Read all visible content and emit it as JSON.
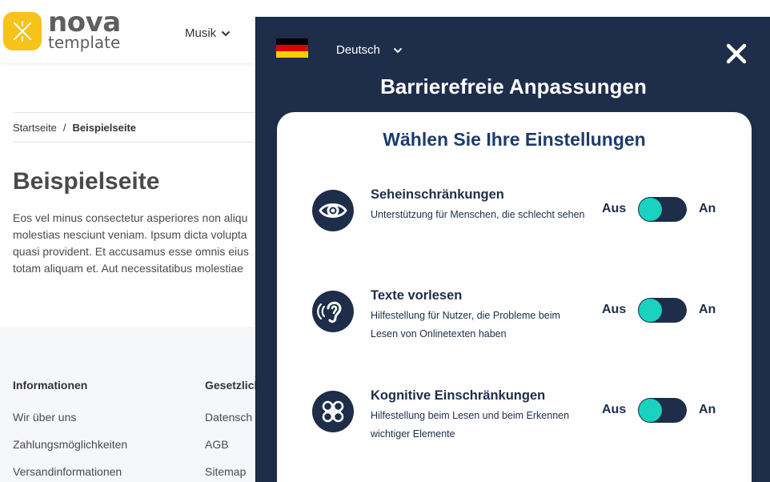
{
  "header": {
    "logo_word": "nova",
    "logo_sub": "template",
    "nav_item": "Musik"
  },
  "breadcrumb": {
    "home": "Startseite",
    "separator": "/",
    "current": "Beispielseite"
  },
  "page": {
    "title": "Beispielseite",
    "body_lines": [
      "Eos vel minus consectetur asperiores non aliqu",
      "molestias nesciunt veniam. Ipsum dicta volupta",
      "quasi provident. Et accusamus esse omnis eius",
      "totam aliquam et. Aut necessitatibus molestiae"
    ]
  },
  "footer": {
    "col1": {
      "heading": "Informationen",
      "links": [
        "Wir über uns",
        "Zahlungsmöglichkeiten",
        "Versandinformationen"
      ]
    },
    "col2": {
      "heading": "Gesetzlich",
      "links": [
        "Datensch",
        "AGB",
        "Sitemap"
      ]
    }
  },
  "accessibility_panel": {
    "language": "Deutsch",
    "flag_colors": [
      "#000000",
      "#dd0000",
      "#ffce00"
    ],
    "title": "Barrierefreie Anpassungen",
    "card_title": "Wählen Sie Ihre Einstellungen",
    "off_label": "Aus",
    "on_label": "An",
    "options": [
      {
        "title": "Seheinschränkungen",
        "desc": "Unterstützung für Menschen, die schlecht sehen",
        "icon": "eye-icon",
        "state": "Aus"
      },
      {
        "title": "Texte vorlesen",
        "desc": "Hilfestellung für Nutzer, die Probleme beim Lesen von Onlinetexten haben",
        "icon": "ear-icon",
        "state": "Aus"
      },
      {
        "title": "Kognitive Einschränkungen",
        "desc": "Hilfestellung beim Lesen und beim Erkennen wichtiger Elemente",
        "icon": "cognitive-icon",
        "state": "Aus"
      }
    ]
  },
  "colors": {
    "panel_bg": "#1d2d4a",
    "card_title": "#1d3b6b",
    "toggle_knob": "#19d2c0",
    "logo_yellow": "#f7c21a"
  }
}
